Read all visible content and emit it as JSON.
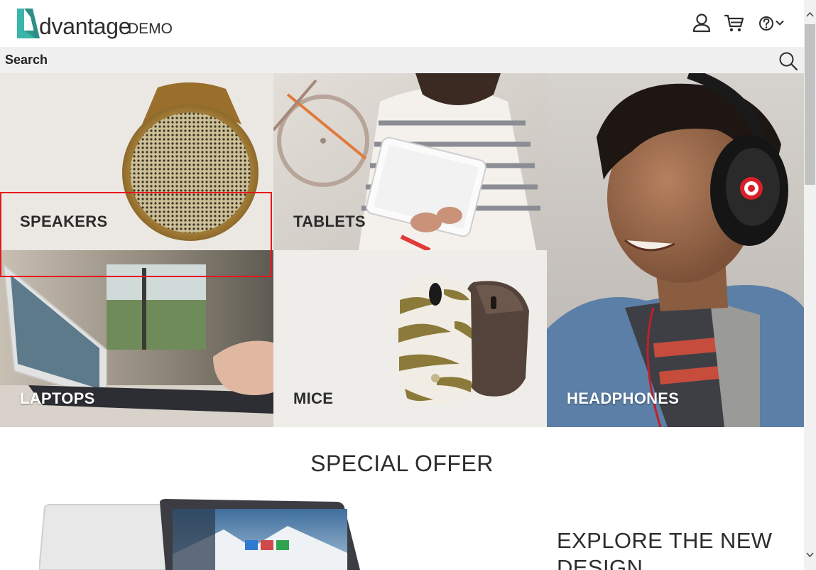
{
  "header": {
    "logo_text": "dvantage",
    "logo_suffix": "DEMO",
    "accent_color": "#3ab5aa"
  },
  "icons": {
    "user": "user-icon",
    "cart": "cart-icon",
    "help": "help-icon",
    "help_menu": "chevron-down-icon",
    "search": "search-icon"
  },
  "search": {
    "placeholder": "Search",
    "value": ""
  },
  "categories": [
    {
      "label": "SPEAKERS"
    },
    {
      "label": "TABLETS"
    },
    {
      "label": "HEADPHONES"
    },
    {
      "label": "LAPTOPS"
    },
    {
      "label": "MICE"
    }
  ],
  "highlight_color": "#e8161c",
  "special_offer": {
    "title": "SPECIAL OFFER",
    "headline": "EXPLORE THE NEW DESIGN"
  }
}
